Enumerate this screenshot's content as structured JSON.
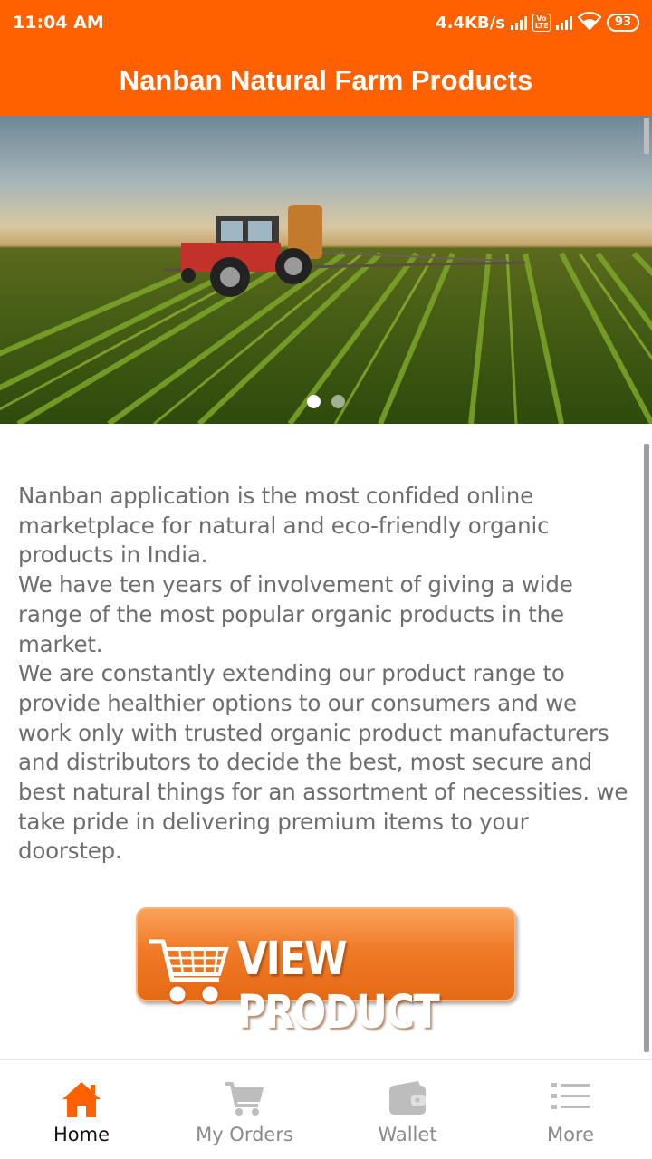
{
  "status_bar": {
    "time": "11:04 AM",
    "network_speed": "4.4KB/s",
    "volte": "Vo LTE",
    "battery": "93",
    "icons": [
      "signal-icon",
      "volte-icon",
      "signal-icon",
      "wifi-icon",
      "battery-icon"
    ]
  },
  "app_bar": {
    "title": "Nanban Natural Farm Products"
  },
  "banner": {
    "image": "tractor-in-farm-field",
    "slide_count": 2,
    "active_slide": 1
  },
  "description": {
    "paragraphs": [
      "Nanban application is the most confided online marketplace for natural and eco-friendly organic products in India.",
      "We have ten years of involvement of giving a wide range of the most popular organic products in the market.",
      "We are constantly extending our product range to provide healthier options to our consumers and we work only with trusted organic product manufacturers and distributors to decide the best, most secure and best natural things for an assortment of necessities. we take pride in delivering premium items to your doorstep."
    ]
  },
  "view_product_button": {
    "label": "VIEW PRODUCT",
    "icon": "shopping-cart-icon"
  },
  "bottom_nav": {
    "active_color": "#ff6000",
    "inactive_color": "#bdbdbd",
    "items": [
      {
        "label": "Home",
        "icon": "home-icon",
        "active": true
      },
      {
        "label": "My Orders",
        "icon": "cart-icon",
        "active": false
      },
      {
        "label": "Wallet",
        "icon": "wallet-icon",
        "active": false
      },
      {
        "label": "More",
        "icon": "list-icon",
        "active": false
      }
    ]
  },
  "colors": {
    "primary": "#ff6000",
    "text": "#6d6d6d"
  }
}
